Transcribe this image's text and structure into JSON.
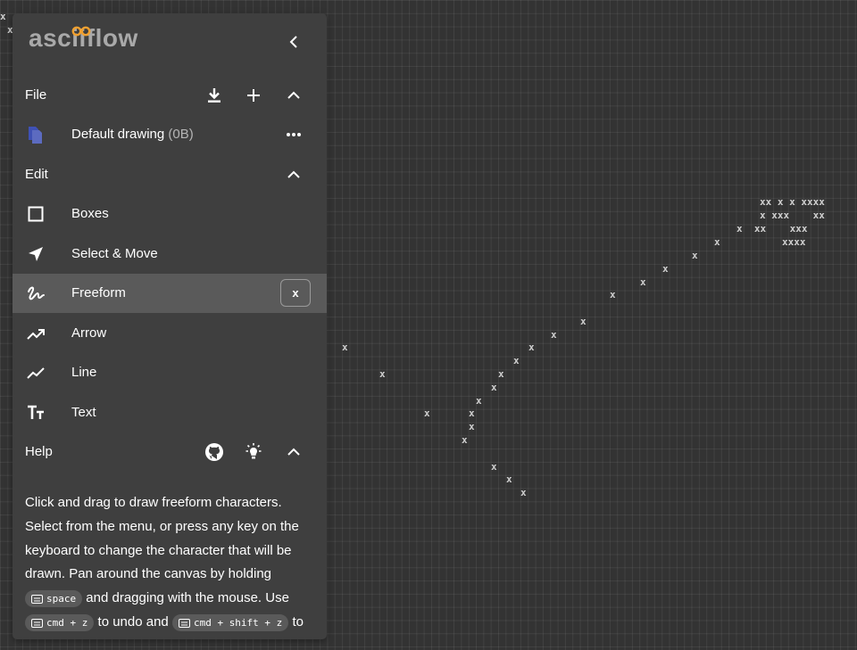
{
  "app": {
    "logo": "asciiflow"
  },
  "file": {
    "label": "File",
    "drawing_name": "Default drawing",
    "drawing_size": "(0B)"
  },
  "edit": {
    "label": "Edit",
    "tools": [
      {
        "label": "Boxes",
        "icon": "square-outline-icon"
      },
      {
        "label": "Select & Move",
        "icon": "cursor-arrow-icon"
      },
      {
        "label": "Freeform",
        "icon": "gesture-icon",
        "active": true,
        "char": "x"
      },
      {
        "label": "Arrow",
        "icon": "trending-up-icon"
      },
      {
        "label": "Line",
        "icon": "show-chart-icon"
      },
      {
        "label": "Text",
        "icon": "text-fields-icon"
      }
    ]
  },
  "help": {
    "label": "Help",
    "text_1": "Click and drag to draw freeform characters. Select from the menu, or press any key on the keyboard to change the character that will be drawn. Pan around the canvas by holding",
    "key_space": "space",
    "text_2": "and dragging with the mouse. Use",
    "key_undo": "cmd + z",
    "text_3": "to undo and",
    "key_redo": "cmd + shift + z",
    "text_4": "to"
  },
  "colors": {
    "canvas_bg": "#333333",
    "panel_bg": "#3f3f3f",
    "active_row": "#5a5a5a",
    "accent_blue": "#3f51b5",
    "logo_orange": "#f0a030"
  },
  "canvas_text": [
    "x",
    "x",
    "xx x x xxxx",
    "x xxx    xx",
    "x  xx    xxx",
    "xxxx",
    "x",
    "x",
    "x",
    "x",
    "x",
    "x",
    "x",
    "x",
    "x",
    "x",
    "x",
    "x",
    "x",
    "x",
    "x",
    "x",
    "x",
    "x",
    "x",
    "x",
    "x",
    "x",
    "x"
  ]
}
